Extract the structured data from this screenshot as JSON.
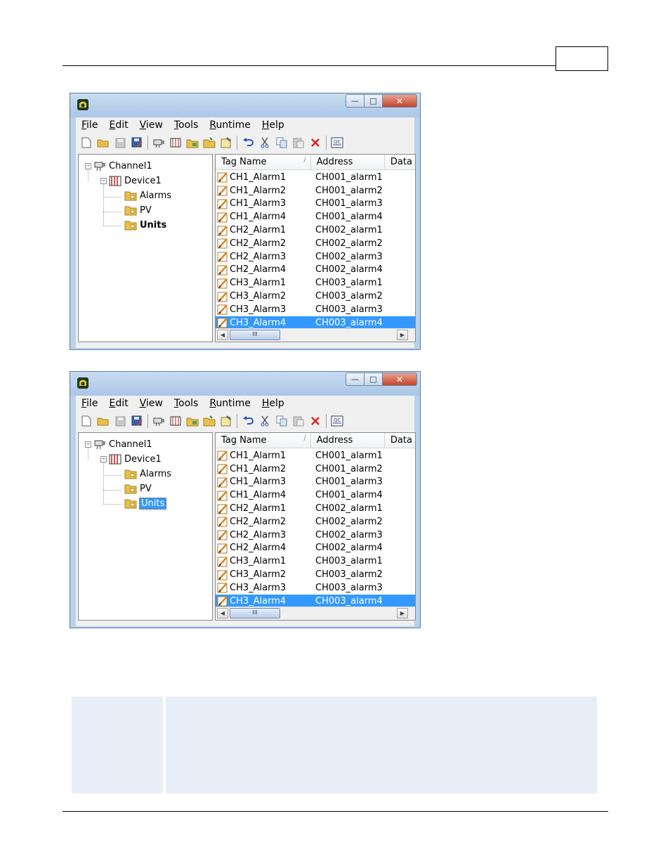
{
  "windows": [
    {
      "menu": [
        "File",
        "Edit",
        "View",
        "Tools",
        "Runtime",
        "Help"
      ],
      "tree": {
        "channel": "Channel1",
        "device": "Device1",
        "groups": [
          "Alarms",
          "PV",
          "Units"
        ],
        "active_group": "Units",
        "active_style": "bold"
      },
      "columns": [
        "Tag Name",
        "Address",
        "Data"
      ],
      "rows": [
        {
          "tag": "CH1_Alarm1",
          "address": "CH001_alarm1"
        },
        {
          "tag": "CH1_Alarm2",
          "address": "CH001_alarm2"
        },
        {
          "tag": "CH1_Alarm3",
          "address": "CH001_alarm3"
        },
        {
          "tag": "CH1_Alarm4",
          "address": "CH001_alarm4"
        },
        {
          "tag": "CH2_Alarm1",
          "address": "CH002_alarm1"
        },
        {
          "tag": "CH2_Alarm2",
          "address": "CH002_alarm2"
        },
        {
          "tag": "CH2_Alarm3",
          "address": "CH002_alarm3"
        },
        {
          "tag": "CH2_Alarm4",
          "address": "CH002_alarm4"
        },
        {
          "tag": "CH3_Alarm1",
          "address": "CH003_alarm1"
        },
        {
          "tag": "CH3_Alarm2",
          "address": "CH003_alarm2"
        },
        {
          "tag": "CH3_Alarm3",
          "address": "CH003_alarm3"
        },
        {
          "tag": "CH3_Alarm4",
          "address": "CH003_alarm4"
        }
      ],
      "selected_row": "CH3_Alarm4",
      "scroll_thumb": "III"
    },
    {
      "menu": [
        "File",
        "Edit",
        "View",
        "Tools",
        "Runtime",
        "Help"
      ],
      "tree": {
        "channel": "Channel1",
        "device": "Device1",
        "groups": [
          "Alarms",
          "PV",
          "Units"
        ],
        "active_group": "Units",
        "active_style": "selected-editing"
      },
      "columns": [
        "Tag Name",
        "Address",
        "Data"
      ],
      "rows": [
        {
          "tag": "CH1_Alarm1",
          "address": "CH001_alarm1"
        },
        {
          "tag": "CH1_Alarm2",
          "address": "CH001_alarm2"
        },
        {
          "tag": "CH1_Alarm3",
          "address": "CH001_alarm3"
        },
        {
          "tag": "CH1_Alarm4",
          "address": "CH001_alarm4"
        },
        {
          "tag": "CH2_Alarm1",
          "address": "CH002_alarm1"
        },
        {
          "tag": "CH2_Alarm2",
          "address": "CH002_alarm2"
        },
        {
          "tag": "CH2_Alarm3",
          "address": "CH002_alarm3"
        },
        {
          "tag": "CH2_Alarm4",
          "address": "CH002_alarm4"
        },
        {
          "tag": "CH3_Alarm1",
          "address": "CH003_alarm1"
        },
        {
          "tag": "CH3_Alarm2",
          "address": "CH003_alarm2"
        },
        {
          "tag": "CH3_Alarm3",
          "address": "CH003_alarm3"
        },
        {
          "tag": "CH3_Alarm4",
          "address": "CH003_alarm4"
        }
      ],
      "selected_row": "CH3_Alarm4",
      "scroll_thumb": "III"
    }
  ],
  "toolbar_icons": [
    "new-icon",
    "open-icon",
    "save-icon",
    "save-as-icon",
    "new-channel-icon",
    "new-device-icon",
    "new-group-icon",
    "new-tag-icon",
    "properties-icon",
    "undo-icon",
    "cut-icon",
    "copy-icon",
    "paste-icon",
    "delete-icon",
    "quick-client-icon"
  ],
  "colors": {
    "selection": "#3399ff",
    "titlebar": "#b9d1ea",
    "note_background": "#e7eef7"
  }
}
